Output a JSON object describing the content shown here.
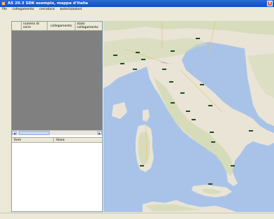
{
  "window": {
    "title": "AS 20.3 SDK esempio, mappa d'Italia",
    "close_glyph": "X"
  },
  "menu": {
    "items": [
      "file",
      "collegamento",
      "cercatura",
      "autorizzazioni"
    ]
  },
  "grid": {
    "columns": [
      "",
      "numero di serie",
      "collegamento",
      "stato collegamento"
    ]
  },
  "properties": {
    "columns": [
      "Item",
      "Value"
    ]
  },
  "scroll": {
    "left_glyph": "◀",
    "right_glyph": "▶"
  },
  "map": {
    "colors": {
      "sea": "#a9c3e8",
      "land": "#e9e4d6",
      "hills": "#cfd9b0",
      "marker": "#3c8c3c"
    },
    "markers": [
      "",
      "",
      "",
      "",
      "",
      "",
      "",
      "",
      "",
      "",
      "",
      "",
      "",
      "",
      "",
      "",
      "",
      "",
      "",
      "",
      ""
    ]
  }
}
